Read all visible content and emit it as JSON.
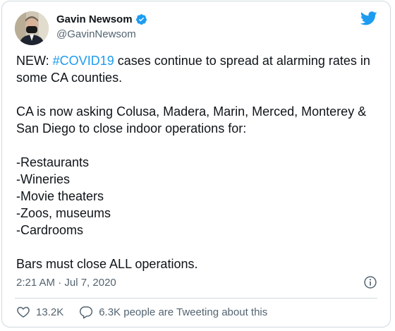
{
  "author": {
    "name": "Gavin Newsom",
    "handle": "@GavinNewsom",
    "verified": true
  },
  "tweet": {
    "prefix": "NEW: ",
    "hashtag": "#COVID19",
    "line1_rest": " cases continue to spread at alarming rates in some CA counties.",
    "body": "\n\nCA is now asking Colusa, Madera, Marin, Merced, Monterey & San Diego to close indoor operations for:\n\n-Restaurants\n-Wineries\n-Movie theaters\n-Zoos, museums\n-Cardrooms\n\nBars must close ALL operations.",
    "timestamp": "2:21 AM · Jul 7, 2020"
  },
  "actions": {
    "likes": "13.2K",
    "replies_label": "6.3K people are Tweeting about this"
  },
  "colors": {
    "brand": "#1d9bf0",
    "text": "#0f1419",
    "secondary": "#536471",
    "border": "#cfd9de"
  },
  "icons": {
    "logo": "twitter-bird-icon",
    "verified": "verified-badge-icon",
    "info": "info-icon",
    "like": "heart-icon",
    "reply": "speech-bubble-icon"
  }
}
